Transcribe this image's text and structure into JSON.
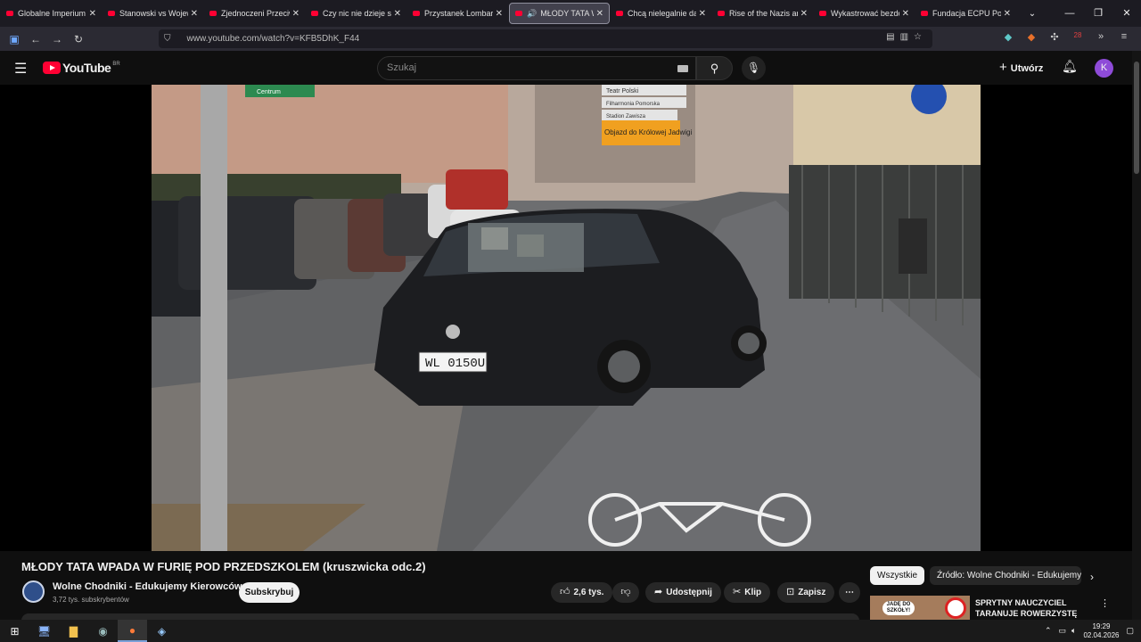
{
  "tabs": [
    {
      "title": "Globalne Imperium B",
      "active": false
    },
    {
      "title": "Stanowski vs Wojewó",
      "active": false
    },
    {
      "title": "Zjednoczeni Przeciw",
      "active": false
    },
    {
      "title": "Czy nic nie dzieje się",
      "active": false
    },
    {
      "title": "Przystanek Lombard",
      "active": false
    },
    {
      "title": "MŁODY TATA WP",
      "active": true
    },
    {
      "title": "Chcą nielegalnie dan",
      "active": false
    },
    {
      "title": "Rise of the Nazis and",
      "active": false
    },
    {
      "title": "Wykastrować bezdom",
      "active": false
    },
    {
      "title": "Fundacja ECPU Polsk",
      "active": false
    }
  ],
  "browser": {
    "url": "www.youtube.com/watch?v=KFB5DhK_F44",
    "ext_badge": "28"
  },
  "youtube": {
    "logo": "YouTube",
    "country": "BR",
    "search_placeholder": "Szukaj",
    "create_label": "Utwórz",
    "avatar_letter": "K"
  },
  "video": {
    "plate": "WL 0150U",
    "sign_top": "Teatr Polski",
    "sign_mid": "Filharmonia Pomorska",
    "sign_mid2": "Stadion Zawisza",
    "detour": "Objazd do Królowej Jadwigi",
    "street_sign": "Centrum",
    "title": "MŁODY TATA WPADA W FURIĘ POD PRZEDSZKOLEM (kruszwicka odc.2)",
    "channel": "Wolne Chodniki - Edukujemy Kierowców",
    "subscribers": "3,72 tys. subskrybentów",
    "subscribe": "Subskrybuj",
    "likes": "2,6 tys.",
    "share": "Udostępnij",
    "clip": "Klip",
    "save": "Zapisz"
  },
  "sidebar": {
    "chip_all": "Wszystkie",
    "chip_source": "Źródło: Wolne Chodniki - Edukujemy Kierowców",
    "rec_title": "SPRYTNY NAUCZYCIEL TARANUJE ROWERZYSTĘ PO...",
    "rec_thumb_text": "JADĘ DO SZKOŁY!"
  },
  "taskbar": {
    "time": "19:29",
    "date": "02.04.2026"
  },
  "colors": {
    "youtube_red": "#ff0033",
    "avatar": "#8e4bd8"
  }
}
